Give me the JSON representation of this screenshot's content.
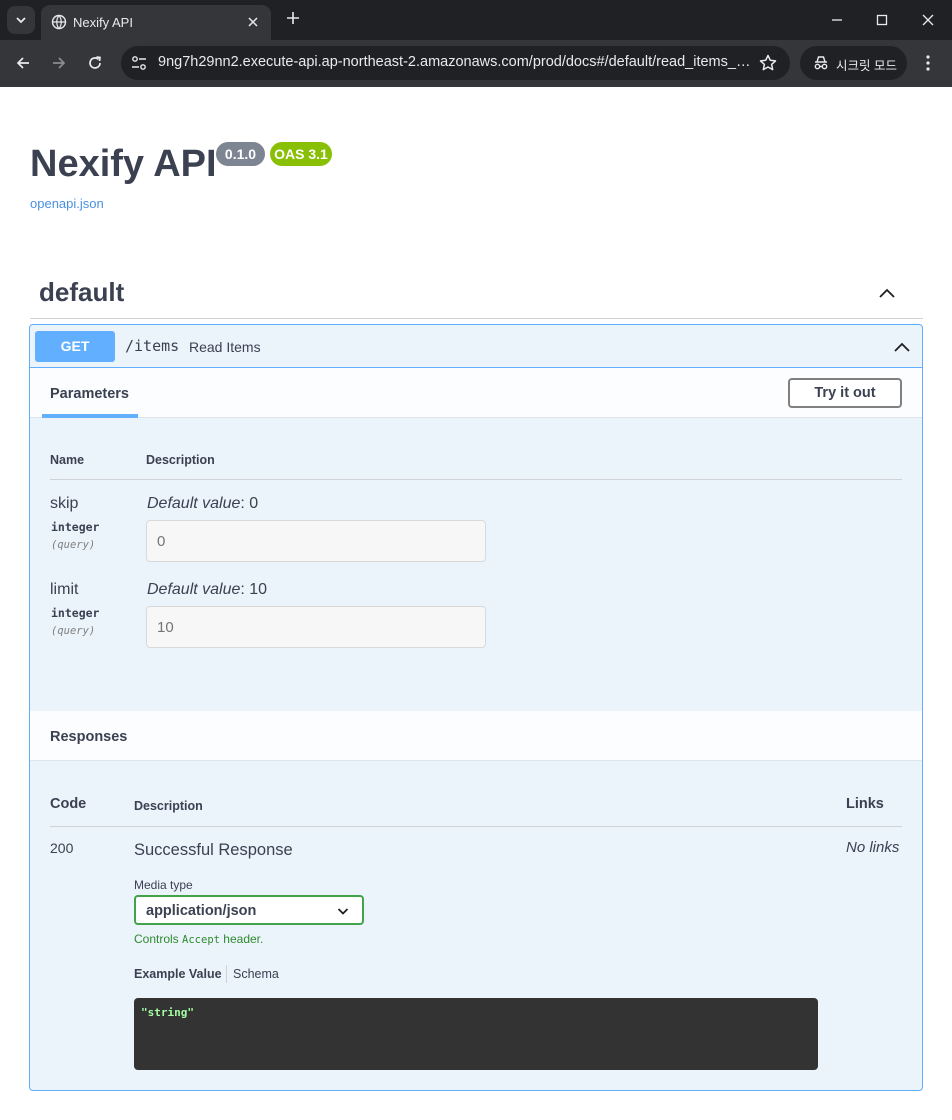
{
  "browser": {
    "tab_title": "Nexify API",
    "url": "9ng7h29nn2.execute-api.ap-northeast-2.amazonaws.com/prod/docs#/default/read_items_it...",
    "incognito_label": "시크릿 모드"
  },
  "api": {
    "title": "Nexify API",
    "version": "0.1.0",
    "oas": "OAS 3.1",
    "spec_link": "openapi.json"
  },
  "tag": {
    "name": "default"
  },
  "operation": {
    "method": "GET",
    "path": "/items",
    "summary": "Read Items",
    "parameters_tab": "Parameters",
    "try_it_out": "Try it out",
    "columns": {
      "name": "Name",
      "description": "Description"
    },
    "params": [
      {
        "name": "skip",
        "type": "integer",
        "in": "(query)",
        "default_label": "Default value",
        "default_value": ": 0",
        "placeholder": "0"
      },
      {
        "name": "limit",
        "type": "integer",
        "in": "(query)",
        "default_label": "Default value",
        "default_value": ": 10",
        "placeholder": "10"
      }
    ]
  },
  "responses": {
    "header": "Responses",
    "columns": {
      "code": "Code",
      "description": "Description",
      "links": "Links"
    },
    "items": [
      {
        "code": "200",
        "description": "Successful Response",
        "links": "No links",
        "media_type_label": "Media type",
        "media_type": "application/json",
        "controls_prefix": "Controls ",
        "controls_code": "Accept",
        "controls_suffix": " header.",
        "example_tab": "Example Value",
        "schema_tab": "Schema",
        "example": "\"string\""
      }
    ]
  },
  "colors": {
    "get": "#61affe",
    "oas_badge": "#89bf04",
    "version_badge": "#7d8492",
    "media_select_border": "#41a34b"
  }
}
